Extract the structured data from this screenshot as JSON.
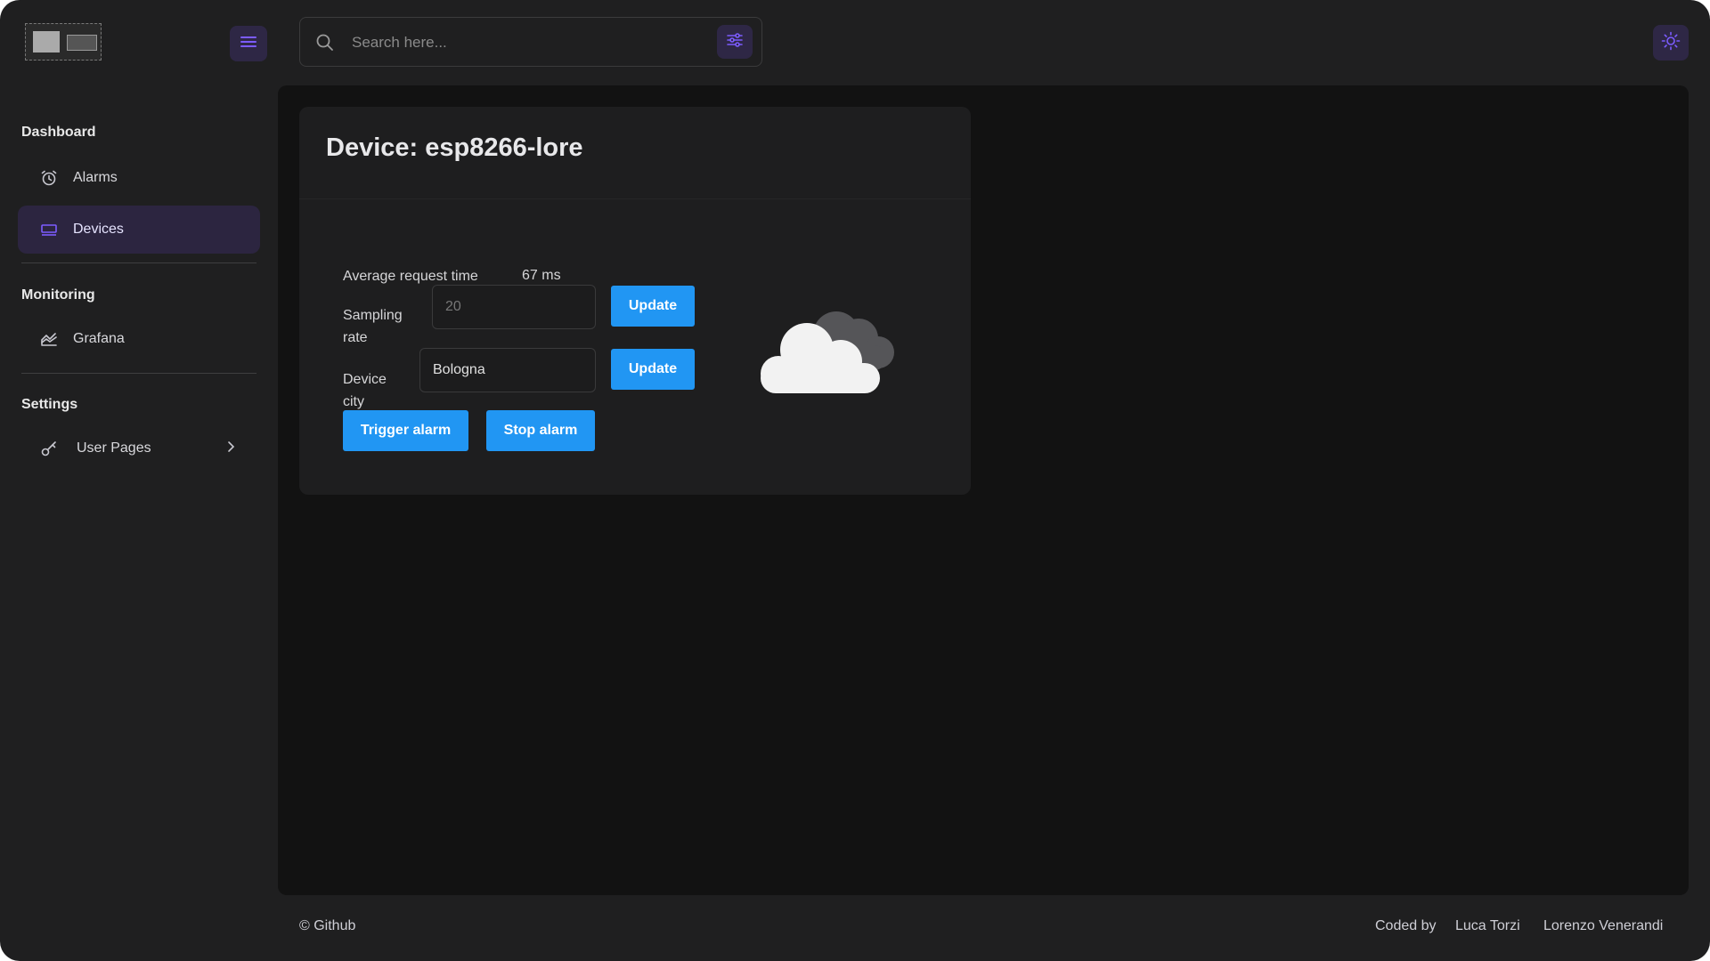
{
  "header": {
    "search_placeholder": "Search here..."
  },
  "sidebar": {
    "sections": [
      {
        "title": "Dashboard",
        "items": [
          {
            "label": "Alarms",
            "icon": "alarm-clock-icon"
          },
          {
            "label": "Devices",
            "icon": "devices-icon",
            "active": true
          }
        ]
      },
      {
        "title": "Monitoring",
        "items": [
          {
            "label": "Grafana",
            "icon": "chart-area-icon"
          }
        ]
      },
      {
        "title": "Settings",
        "items": [
          {
            "label": "User Pages",
            "icon": "key-icon",
            "expandable": true
          }
        ]
      }
    ]
  },
  "device": {
    "title": "Device: esp8266-lore",
    "avg_request_label": "Average request time",
    "avg_request_value": "67 ms",
    "sampling_label_line1": "Sampling",
    "sampling_label_line2": "rate",
    "sampling_placeholder": "20",
    "city_label_line1": "Device",
    "city_label_line2": "city",
    "city_value": "Bologna",
    "update_label": "Update",
    "trigger_alarm_label": "Trigger alarm",
    "stop_alarm_label": "Stop alarm",
    "weather_icon": "cloudy-icon"
  },
  "footer": {
    "copyright": "© Github",
    "coded_by": "Coded by",
    "author1": "Luca Torzi",
    "author2": "Lorenzo Venerandi"
  },
  "colors": {
    "accent": "#7c5cff",
    "primary_button": "#2196f3",
    "active_nav_bg": "#2c2540"
  }
}
